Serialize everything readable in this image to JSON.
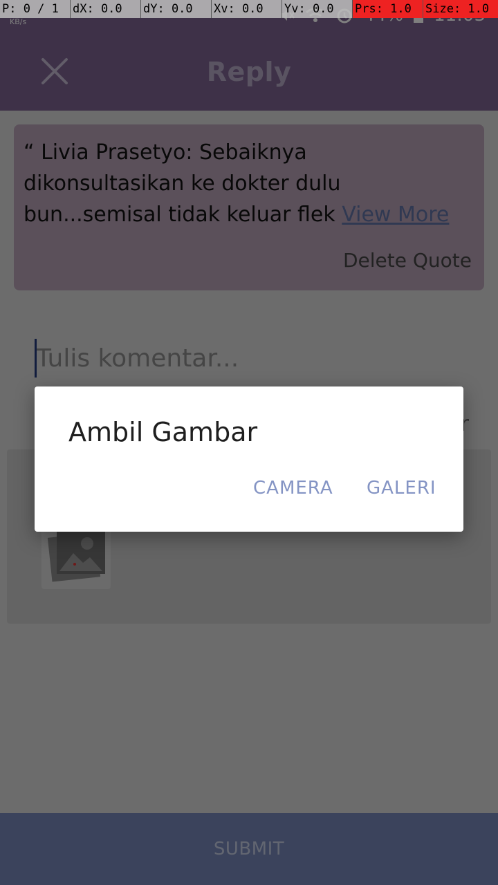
{
  "debug": {
    "pointer": "P: 0 / 1",
    "dx": "dX: 0.0",
    "dy": "dY: 0.0",
    "xv": "Xv: 0.0",
    "yv": "Yv: 0.0",
    "prs": "Prs: 1.0",
    "size": "Size: 1.0"
  },
  "status_bar": {
    "net_unit": "KB/s",
    "battery": "44%",
    "time": "11:03"
  },
  "app_bar": {
    "title": "Reply",
    "close_icon": "close-icon"
  },
  "quote": {
    "text": "“ Livia Prasetyo: Sebaiknya dikonsultasikan ke dokter dulu bun...semisal tidak keluar flek ",
    "view_more": "View More",
    "delete_label": "Delete Quote"
  },
  "comment": {
    "placeholder": "Tulis komentar..."
  },
  "attachment": {
    "thumbnail_icon": "image-placeholder-icon"
  },
  "submit": {
    "label": "SUBMIT"
  },
  "dialog": {
    "title": "Ambil Gambar",
    "camera_label": "CAMERA",
    "gallery_label": "GALERI"
  },
  "colors": {
    "app_bar": "#7c6391",
    "quote_card": "#b6a0b5",
    "submit_bar": "#7687b8",
    "dialog_button": "#8494c4"
  }
}
